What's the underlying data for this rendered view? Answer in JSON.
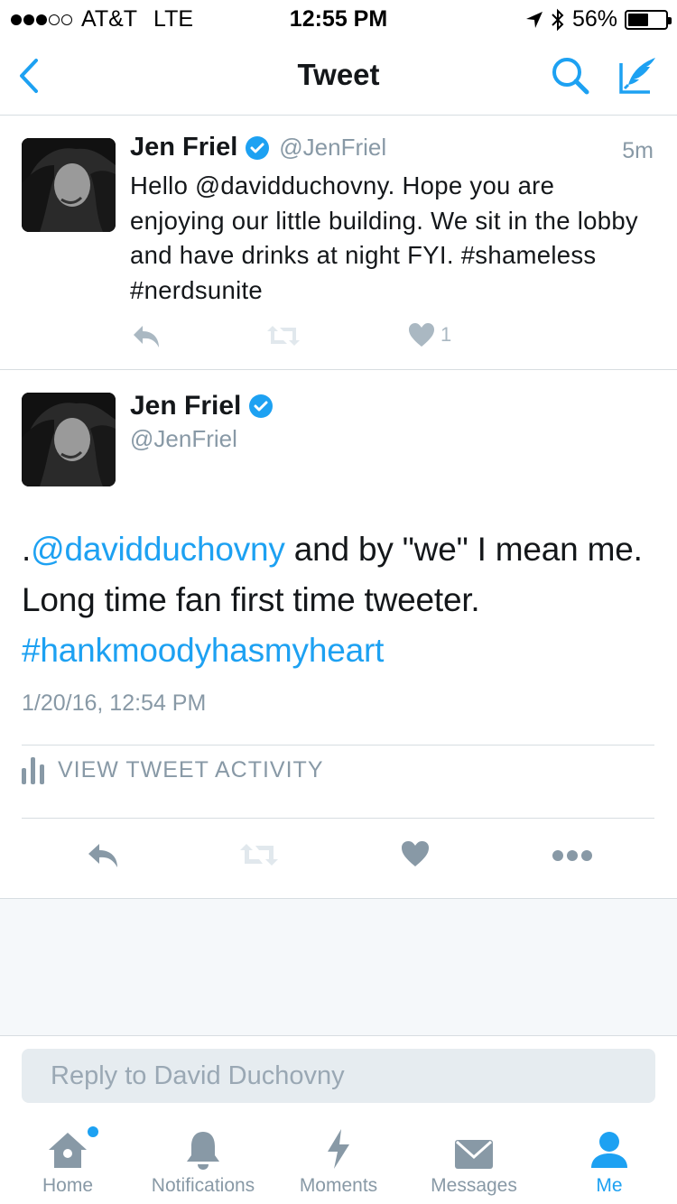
{
  "status_bar": {
    "carrier": "AT&T",
    "network": "LTE",
    "time": "12:55 PM",
    "battery": "56%",
    "battery_level": 0.56
  },
  "nav": {
    "title": "Tweet",
    "back_icon": "chevron-left-icon",
    "search_icon": "search-icon",
    "compose_icon": "compose-tweet-icon"
  },
  "tweets": [
    {
      "name": "Jen Friel",
      "handle": "@JenFriel",
      "time": "5m",
      "text": "Hello @davidduchovny. Hope you are enjoying our little building. We sit in the lobby and have drinks at night FYI. #shameless #nerdsunite",
      "like_count": "1"
    }
  ],
  "focused_tweet": {
    "name": "Jen Friel",
    "handle": "@JenFriel",
    "text_prefix": ".",
    "mention": "@davidduchovny",
    "text_body": " and by \"we\" I mean me. Long time fan first time tweeter. ",
    "hashtag": "#hankmoodyhasmyheart",
    "date": "1/20/16, 12:54 PM",
    "activity_label": "VIEW TWEET ACTIVITY"
  },
  "reply": {
    "placeholder": "Reply to David Duchovny"
  },
  "tabs": [
    {
      "label": "Home",
      "icon": "home-icon"
    },
    {
      "label": "Notifications",
      "icon": "bell-icon"
    },
    {
      "label": "Moments",
      "icon": "lightning-icon"
    },
    {
      "label": "Messages",
      "icon": "envelope-icon"
    },
    {
      "label": "Me",
      "icon": "person-icon"
    }
  ],
  "colors": {
    "accent": "#1da1f2",
    "muted": "#8899a6",
    "icon_gray": "#aab8c2"
  }
}
